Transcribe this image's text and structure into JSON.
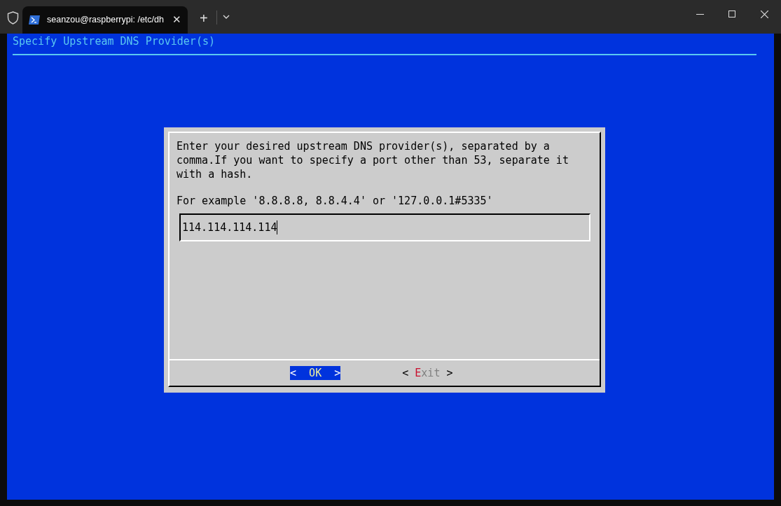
{
  "tab": {
    "title": "seanzou@raspberrypi: /etc/dh",
    "close": "✕",
    "new": "+"
  },
  "header": {
    "title": "Specify Upstream DNS Provider(s)"
  },
  "dialog": {
    "message": "Enter your desired upstream DNS provider(s), separated by a comma.If you want to specify a port other than 53, separate it with a hash.",
    "example": "For example '8.8.8.8, 8.8.4.4' or '127.0.0.1#5335'",
    "input": {
      "value": "114.114.114.114"
    },
    "buttons": [
      {
        "open": "<",
        "label": "OK",
        "close": ">",
        "selected": true
      },
      {
        "open": "<",
        "label": "Exit",
        "close": ">",
        "selected": false
      }
    ]
  }
}
